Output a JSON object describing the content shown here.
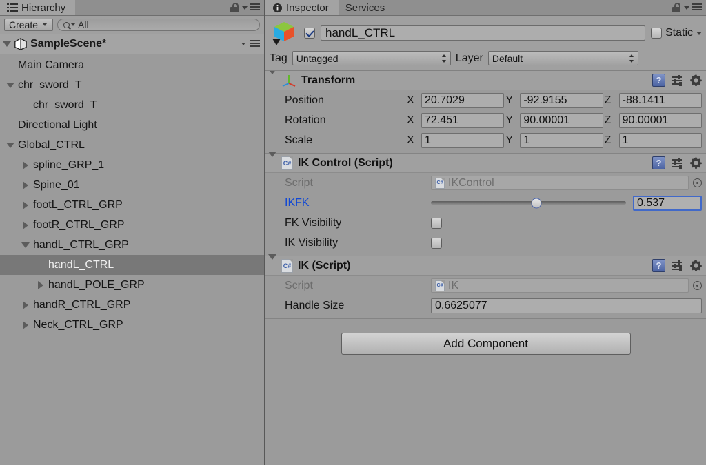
{
  "hierarchy": {
    "tab": {
      "label": "Hierarchy",
      "icon": "hierarchy-list-icon"
    },
    "toolbar": {
      "create_label": "Create",
      "search_value": "All",
      "search_placeholder": "All"
    },
    "scene": {
      "name": "SampleScene*"
    },
    "nodes": [
      {
        "label": "Main Camera",
        "depth": 1,
        "twirl": "none",
        "selected": false
      },
      {
        "label": "chr_sword_T",
        "depth": 1,
        "twirl": "down",
        "selected": false
      },
      {
        "label": "chr_sword_T",
        "depth": 2,
        "twirl": "none",
        "selected": false
      },
      {
        "label": "Directional Light",
        "depth": 1,
        "twirl": "none",
        "selected": false
      },
      {
        "label": "Global_CTRL",
        "depth": 1,
        "twirl": "down",
        "selected": false
      },
      {
        "label": "spline_GRP_1",
        "depth": 2,
        "twirl": "right",
        "selected": false
      },
      {
        "label": "Spine_01",
        "depth": 2,
        "twirl": "right",
        "selected": false
      },
      {
        "label": "footL_CTRL_GRP",
        "depth": 2,
        "twirl": "right",
        "selected": false
      },
      {
        "label": "footR_CTRL_GRP",
        "depth": 2,
        "twirl": "right",
        "selected": false
      },
      {
        "label": "handL_CTRL_GRP",
        "depth": 2,
        "twirl": "down",
        "selected": false
      },
      {
        "label": "handL_CTRL",
        "depth": 3,
        "twirl": "none",
        "selected": true
      },
      {
        "label": "handL_POLE_GRP",
        "depth": 3,
        "twirl": "right",
        "selected": false
      },
      {
        "label": "handR_CTRL_GRP",
        "depth": 2,
        "twirl": "right",
        "selected": false
      },
      {
        "label": "Neck_CTRL_GRP",
        "depth": 2,
        "twirl": "right",
        "selected": false
      }
    ]
  },
  "inspector": {
    "tabs": [
      {
        "label": "Inspector",
        "active": true,
        "icon": "info-icon"
      },
      {
        "label": "Services",
        "active": false,
        "icon": "none"
      }
    ],
    "gameobject": {
      "enabled": true,
      "name": "handL_CTRL",
      "static_label": "Static",
      "static_checked": false,
      "tag_label": "Tag",
      "tag_value": "Untagged",
      "layer_label": "Layer",
      "layer_value": "Default"
    },
    "components": [
      {
        "title": "Transform",
        "icon": "transform-axis-icon",
        "expanded": true,
        "rows": [
          {
            "type": "vector3",
            "label": "Position",
            "x": "20.7029",
            "y": "-92.9155",
            "z": "-88.1411"
          },
          {
            "type": "vector3",
            "label": "Rotation",
            "x": "72.451",
            "y": "90.00001",
            "z": "90.00001"
          },
          {
            "type": "vector3",
            "label": "Scale",
            "x": "1",
            "y": "1",
            "z": "1"
          }
        ]
      },
      {
        "title": "IK Control (Script)",
        "icon": "csharp-script-icon",
        "expanded": true,
        "rows": [
          {
            "type": "object",
            "label": "Script",
            "value": "IKControl"
          },
          {
            "type": "slider",
            "label": "IKFK",
            "value": "0.537",
            "percent": 54
          },
          {
            "type": "checkbox",
            "label": "FK Visibility",
            "checked": false
          },
          {
            "type": "checkbox",
            "label": "IK Visibility",
            "checked": false
          }
        ]
      },
      {
        "title": "IK (Script)",
        "icon": "csharp-script-icon",
        "expanded": true,
        "rows": [
          {
            "type": "object",
            "label": "Script",
            "value": "IK"
          },
          {
            "type": "text",
            "label": "Handle Size",
            "value": "0.6625077"
          }
        ]
      }
    ],
    "add_component_label": "Add Component",
    "axis_labels": {
      "x": "X",
      "y": "Y",
      "z": "Z"
    }
  },
  "colors": {
    "panel_bg": "#9b9b9b",
    "header_bg": "#a0a0a0",
    "selection": "#787878",
    "accent_blue": "#1148d4",
    "focus_border": "#4169c9"
  }
}
